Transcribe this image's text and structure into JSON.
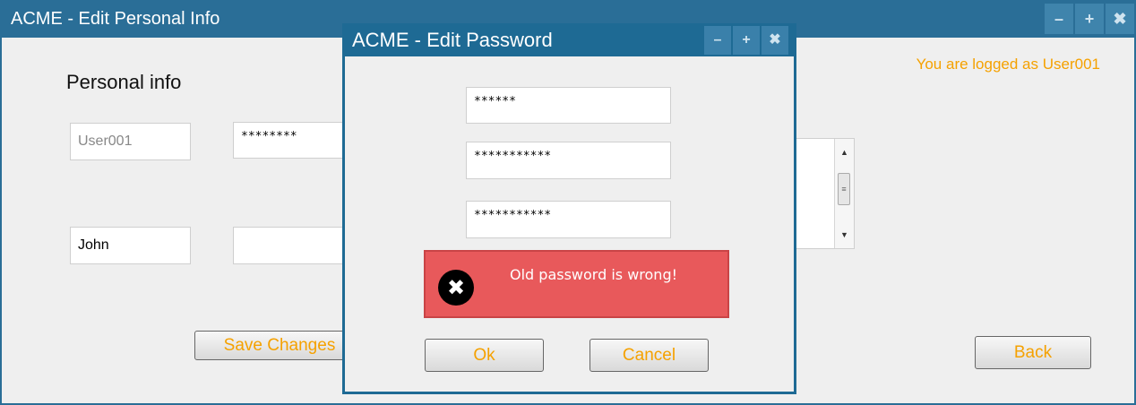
{
  "main_window": {
    "title": "ACME - Edit Personal Info",
    "controls": {
      "minimize": "–",
      "maximize": "+",
      "close": "✖"
    },
    "logged_as": "You are logged as User001",
    "section_title": "Personal info",
    "fields": {
      "username": "User001",
      "password_masked": "********",
      "first_name": "John",
      "last_name": ""
    },
    "textarea_scroll": {
      "up": "▲",
      "grip": "≡",
      "down": "▼"
    },
    "save_button": "Save Changes",
    "back_button": "Back"
  },
  "dialog": {
    "title": "ACME - Edit Password",
    "controls": {
      "minimize": "–",
      "maximize": "+",
      "close": "✖"
    },
    "old_password": "******",
    "new_password": "***********",
    "confirm_password": "***********",
    "error": {
      "icon": "✖",
      "message": "Old password is wrong!"
    },
    "ok_button": "Ok",
    "cancel_button": "Cancel"
  },
  "colors": {
    "titlebar": "#2a6e97",
    "accent_text": "#f5a100",
    "error_bg": "#e8595b"
  }
}
